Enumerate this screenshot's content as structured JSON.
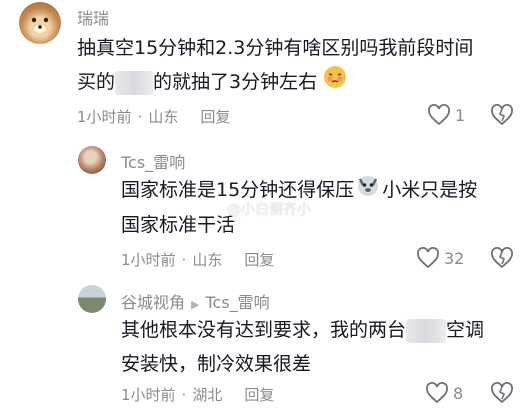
{
  "comments": [
    {
      "username": "瑞瑞",
      "text_line1": "抽真空15分钟和2.3分钟有啥区别吗我前段时间",
      "text_line2_pre": "买的",
      "text_line2_post": "的就抽了3分钟左右",
      "time": "1小时前",
      "location": "山东",
      "reply_label": "回复",
      "likes": "1"
    },
    {
      "username": "Tcs_雷响",
      "text_line1_pre": "国家标准是15分钟还得保压",
      "text_line1_post": "小米只是按",
      "text_line2": "国家标准干活",
      "time": "1小时前",
      "location": "山东",
      "reply_label": "回复",
      "likes": "32"
    },
    {
      "username": "谷城视角",
      "reply_to": "Tcs_雷响",
      "text_line1_pre": "其他根本没有达到要求，我的两台",
      "text_line1_post": "空调",
      "text_line2": "安装快，制冷效果很差",
      "time": "1小时前",
      "location": "湖北",
      "reply_label": "回复",
      "likes": "8"
    }
  ],
  "watermark": "@小白侧齐小",
  "colors": {
    "text": "#161823",
    "meta": "#8a8b91",
    "background": "#ffffff"
  }
}
